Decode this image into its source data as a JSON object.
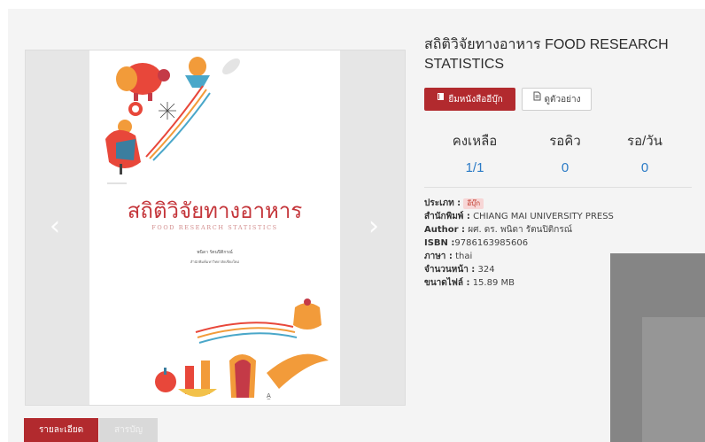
{
  "book": {
    "title": "สถิติวิจัยทางอาหาร FOOD RESEARCH STATISTICS"
  },
  "cover": {
    "title": "สถิติวิจัยทางอาหาร",
    "subtitle": "FOOD RESEARCH STATISTICS",
    "author": "พนิดา รัตนปิติกรณ์",
    "publisher": "สำนักพิมพ์มหาวิทยาลัยเชียงใหม่"
  },
  "actions": {
    "borrow_label": "ยืมหนังสืออีบุ๊ก",
    "preview_label": "ดูตัวอย่าง"
  },
  "stats": {
    "headers": [
      "คงเหลือ",
      "รอคิว",
      "รอ/วัน"
    ],
    "values": [
      "1/1",
      "0",
      "0"
    ]
  },
  "meta": {
    "type_label": "ประเภท :",
    "type_value": "อีบุ๊ก",
    "publisher_label": "สำนักพิมพ์ :",
    "publisher_value": "CHIANG MAI UNIVERSITY PRESS",
    "author_label": "Author :",
    "author_value": "ผศ. ดร. พนิดา รัตนปิติกรณ์",
    "isbn_label": "ISBN :",
    "isbn_value": "9786163985606",
    "language_label": "ภาษา :",
    "language_value": "thai",
    "pages_label": "จำนวนหน้า :",
    "pages_value": "324",
    "filesize_label": "ขนาดไฟล์ :",
    "filesize_value": "15.89 MB"
  },
  "tabs": {
    "details_label": "รายละเอียด",
    "second_label": "สารบัญ"
  },
  "carousel": {
    "prev_glyph": "‹",
    "next_glyph": "›"
  },
  "colors": {
    "accent": "#b22a2e",
    "link": "#2b7bc6"
  }
}
